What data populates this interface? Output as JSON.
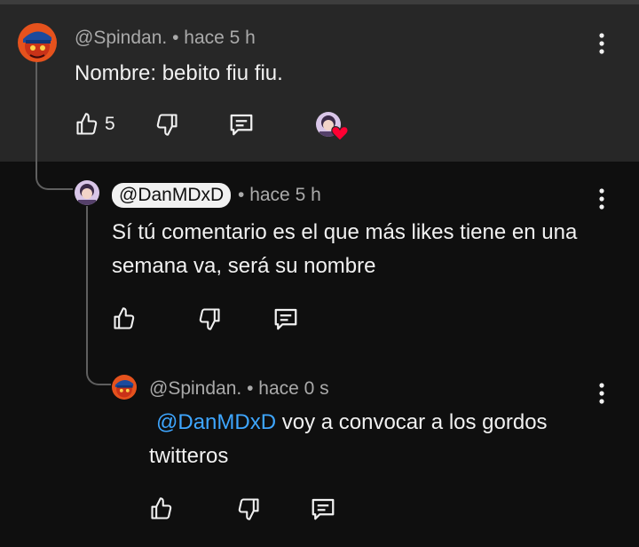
{
  "comments": [
    {
      "author": "@Spindan.",
      "time": "• hace 5 h",
      "text": "Nombre: bebito fiu fiu.",
      "likes": "5",
      "creator_heart": true
    },
    {
      "author": "@DanMDxD",
      "time": "• hace 5 h",
      "text": "Sí tú comentario es el que más likes tiene en una semana va, será su nombre"
    },
    {
      "author": "@Spindan.",
      "time": "• hace 0 s",
      "mention": "@DanMDxD",
      "text": " voy a convocar a los gordos twitteros"
    }
  ],
  "icons": {
    "like": "thumbs-up-icon",
    "dislike": "thumbs-down-icon",
    "reply": "reply-comment-icon",
    "more": "more-vertical-icon",
    "heart": "heart-icon"
  },
  "colors": {
    "background": "#0f0f0f",
    "highlight": "#272727",
    "link": "#3ea6ff",
    "heart": "#ff0033"
  }
}
